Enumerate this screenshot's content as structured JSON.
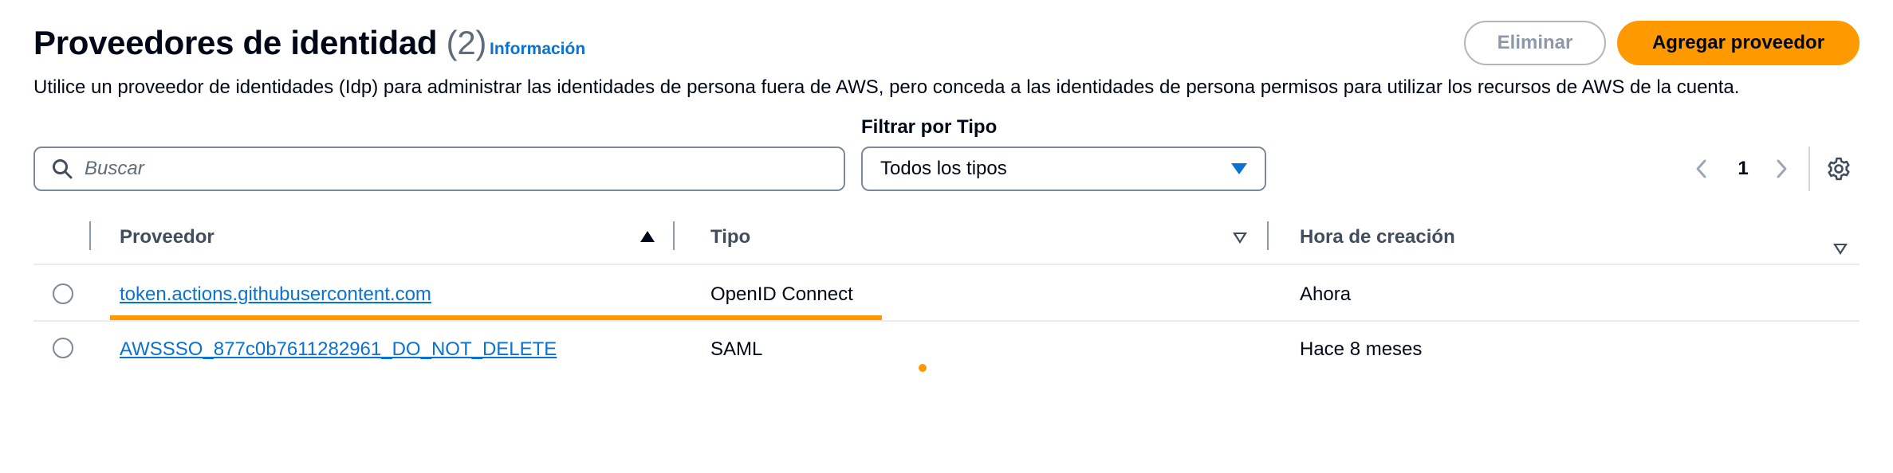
{
  "header": {
    "title": "Proveedores de identidad",
    "count": "(2)",
    "info_link": "Información",
    "description": "Utilice un proveedor de identidades (Idp) para administrar las identidades de persona fuera de AWS, pero conceda a las identidades de persona permisos para utilizar los recursos de AWS de la cuenta."
  },
  "actions": {
    "delete_label": "Eliminar",
    "add_label": "Agregar proveedor"
  },
  "filters": {
    "search_placeholder": "Buscar",
    "type_label": "Filtrar por Tipo",
    "type_value": "Todos los tipos"
  },
  "pagination": {
    "current_page": "1"
  },
  "table": {
    "columns": [
      "Proveedor",
      "Tipo",
      "Hora de creación"
    ],
    "rows": [
      {
        "provider": "token.actions.githubusercontent.com",
        "type": "OpenID Connect",
        "created": "Ahora"
      },
      {
        "provider": "AWSSSO_877c0b7611282961_DO_NOT_DELETE",
        "type": "SAML",
        "created": "Hace 8 meses"
      }
    ]
  },
  "icons": {
    "search": "search-icon",
    "dropdown": "caret-down-icon",
    "prev": "chevron-left-icon",
    "next": "chevron-right-icon",
    "settings": "gear-icon",
    "sort_asc": "sort-ascending-icon",
    "sort_none": "sort-icon"
  },
  "colors": {
    "primary_button": "#ff9900",
    "link": "#0972d3",
    "highlight": "#ff9900",
    "text": "#000716",
    "muted": "#5f6b7a"
  }
}
